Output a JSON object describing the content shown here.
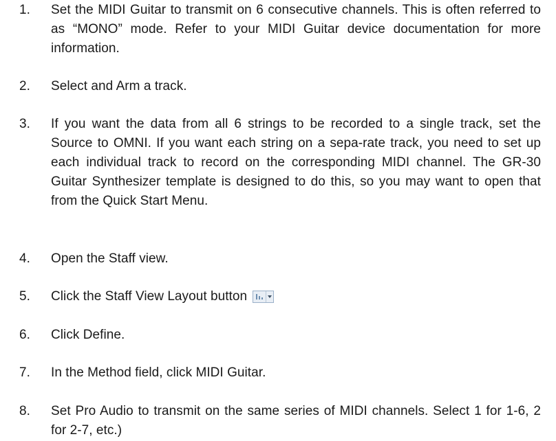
{
  "steps": [
    {
      "number": "1.",
      "text": "Set the MIDI Guitar to transmit on 6 consecutive channels. This is often referred to as “MONO” mode. Refer to your MIDI Guitar device documentation for more information."
    },
    {
      "number": "2.",
      "text": "Select and Arm a track."
    },
    {
      "number": "3.",
      "text": "If you want the data from all 6 strings to be recorded to a single track, set the Source to OMNI. If you want each string on a sepa-rate track, you need to set up each individual track to record on the corresponding MIDI channel. The GR-30 Guitar Synthesizer template is designed to do this, so you may want to open that from the Quick Start Menu."
    },
    {
      "number": "4.",
      "text": "Open the Staff view."
    },
    {
      "number": "5.",
      "text": "Click the Staff View Layout button",
      "icon": "staff-view-layout-button-icon"
    },
    {
      "number": "6.",
      "text": "Click Define."
    },
    {
      "number": "7.",
      "text": "In the Method field, click MIDI Guitar."
    },
    {
      "number": "8.",
      "text": "Set Pro Audio to transmit on the same series of MIDI channels. Select 1 for 1-6, 2 for 2-7, etc.)"
    }
  ]
}
